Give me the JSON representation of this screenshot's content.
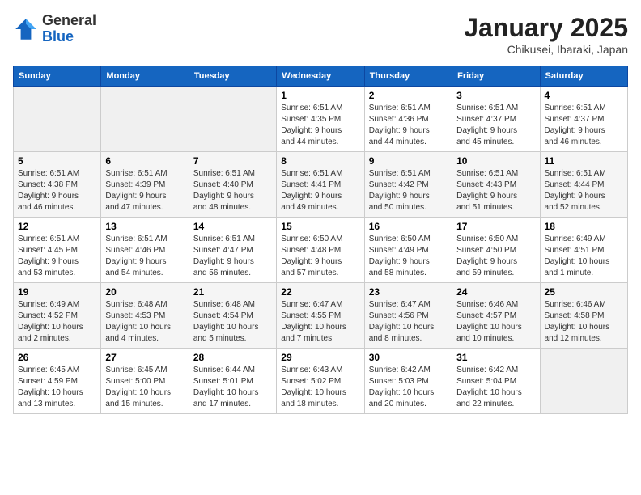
{
  "header": {
    "logo_general": "General",
    "logo_blue": "Blue",
    "month_title": "January 2025",
    "location": "Chikusei, Ibaraki, Japan"
  },
  "days_of_week": [
    "Sunday",
    "Monday",
    "Tuesday",
    "Wednesday",
    "Thursday",
    "Friday",
    "Saturday"
  ],
  "weeks": [
    [
      {
        "day": "",
        "info": ""
      },
      {
        "day": "",
        "info": ""
      },
      {
        "day": "",
        "info": ""
      },
      {
        "day": "1",
        "info": "Sunrise: 6:51 AM\nSunset: 4:35 PM\nDaylight: 9 hours\nand 44 minutes."
      },
      {
        "day": "2",
        "info": "Sunrise: 6:51 AM\nSunset: 4:36 PM\nDaylight: 9 hours\nand 44 minutes."
      },
      {
        "day": "3",
        "info": "Sunrise: 6:51 AM\nSunset: 4:37 PM\nDaylight: 9 hours\nand 45 minutes."
      },
      {
        "day": "4",
        "info": "Sunrise: 6:51 AM\nSunset: 4:37 PM\nDaylight: 9 hours\nand 46 minutes."
      }
    ],
    [
      {
        "day": "5",
        "info": "Sunrise: 6:51 AM\nSunset: 4:38 PM\nDaylight: 9 hours\nand 46 minutes."
      },
      {
        "day": "6",
        "info": "Sunrise: 6:51 AM\nSunset: 4:39 PM\nDaylight: 9 hours\nand 47 minutes."
      },
      {
        "day": "7",
        "info": "Sunrise: 6:51 AM\nSunset: 4:40 PM\nDaylight: 9 hours\nand 48 minutes."
      },
      {
        "day": "8",
        "info": "Sunrise: 6:51 AM\nSunset: 4:41 PM\nDaylight: 9 hours\nand 49 minutes."
      },
      {
        "day": "9",
        "info": "Sunrise: 6:51 AM\nSunset: 4:42 PM\nDaylight: 9 hours\nand 50 minutes."
      },
      {
        "day": "10",
        "info": "Sunrise: 6:51 AM\nSunset: 4:43 PM\nDaylight: 9 hours\nand 51 minutes."
      },
      {
        "day": "11",
        "info": "Sunrise: 6:51 AM\nSunset: 4:44 PM\nDaylight: 9 hours\nand 52 minutes."
      }
    ],
    [
      {
        "day": "12",
        "info": "Sunrise: 6:51 AM\nSunset: 4:45 PM\nDaylight: 9 hours\nand 53 minutes."
      },
      {
        "day": "13",
        "info": "Sunrise: 6:51 AM\nSunset: 4:46 PM\nDaylight: 9 hours\nand 54 minutes."
      },
      {
        "day": "14",
        "info": "Sunrise: 6:51 AM\nSunset: 4:47 PM\nDaylight: 9 hours\nand 56 minutes."
      },
      {
        "day": "15",
        "info": "Sunrise: 6:50 AM\nSunset: 4:48 PM\nDaylight: 9 hours\nand 57 minutes."
      },
      {
        "day": "16",
        "info": "Sunrise: 6:50 AM\nSunset: 4:49 PM\nDaylight: 9 hours\nand 58 minutes."
      },
      {
        "day": "17",
        "info": "Sunrise: 6:50 AM\nSunset: 4:50 PM\nDaylight: 9 hours\nand 59 minutes."
      },
      {
        "day": "18",
        "info": "Sunrise: 6:49 AM\nSunset: 4:51 PM\nDaylight: 10 hours\nand 1 minute."
      }
    ],
    [
      {
        "day": "19",
        "info": "Sunrise: 6:49 AM\nSunset: 4:52 PM\nDaylight: 10 hours\nand 2 minutes."
      },
      {
        "day": "20",
        "info": "Sunrise: 6:48 AM\nSunset: 4:53 PM\nDaylight: 10 hours\nand 4 minutes."
      },
      {
        "day": "21",
        "info": "Sunrise: 6:48 AM\nSunset: 4:54 PM\nDaylight: 10 hours\nand 5 minutes."
      },
      {
        "day": "22",
        "info": "Sunrise: 6:47 AM\nSunset: 4:55 PM\nDaylight: 10 hours\nand 7 minutes."
      },
      {
        "day": "23",
        "info": "Sunrise: 6:47 AM\nSunset: 4:56 PM\nDaylight: 10 hours\nand 8 minutes."
      },
      {
        "day": "24",
        "info": "Sunrise: 6:46 AM\nSunset: 4:57 PM\nDaylight: 10 hours\nand 10 minutes."
      },
      {
        "day": "25",
        "info": "Sunrise: 6:46 AM\nSunset: 4:58 PM\nDaylight: 10 hours\nand 12 minutes."
      }
    ],
    [
      {
        "day": "26",
        "info": "Sunrise: 6:45 AM\nSunset: 4:59 PM\nDaylight: 10 hours\nand 13 minutes."
      },
      {
        "day": "27",
        "info": "Sunrise: 6:45 AM\nSunset: 5:00 PM\nDaylight: 10 hours\nand 15 minutes."
      },
      {
        "day": "28",
        "info": "Sunrise: 6:44 AM\nSunset: 5:01 PM\nDaylight: 10 hours\nand 17 minutes."
      },
      {
        "day": "29",
        "info": "Sunrise: 6:43 AM\nSunset: 5:02 PM\nDaylight: 10 hours\nand 18 minutes."
      },
      {
        "day": "30",
        "info": "Sunrise: 6:42 AM\nSunset: 5:03 PM\nDaylight: 10 hours\nand 20 minutes."
      },
      {
        "day": "31",
        "info": "Sunrise: 6:42 AM\nSunset: 5:04 PM\nDaylight: 10 hours\nand 22 minutes."
      },
      {
        "day": "",
        "info": ""
      }
    ]
  ]
}
